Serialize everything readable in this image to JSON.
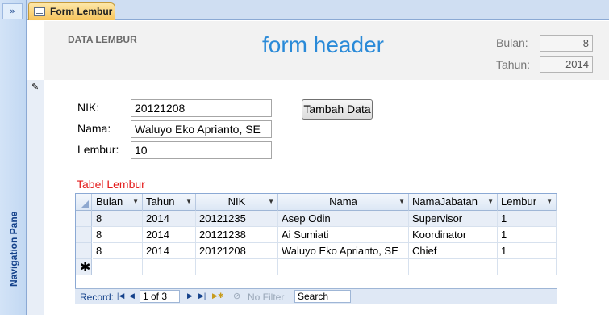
{
  "nav_pane": {
    "toggle": "»",
    "label": "Navigation Pane"
  },
  "tab": {
    "label": "Form Lembur"
  },
  "header": {
    "section_label": "DATA LEMBUR",
    "title": "form header",
    "bulan_label": "Bulan:",
    "bulan_value": "8",
    "tahun_label": "Tahun:",
    "tahun_value": "2014"
  },
  "detail": {
    "nik_label": "NIK:",
    "nik_value": "20121208",
    "nama_label": "Nama:",
    "nama_value": "Waluyo Eko Aprianto, SE",
    "lembur_label": "Lembur:",
    "lembur_value": "10",
    "add_button": "Tambah Data",
    "table_title": "Tabel Lembur"
  },
  "datasheet": {
    "columns": [
      "Bulan",
      "Tahun",
      "NIK",
      "Nama",
      "NamaJabatan",
      "Lembur"
    ],
    "rows": [
      [
        "8",
        "2014",
        "20121235",
        "Asep Odin",
        "Supervisor",
        "1"
      ],
      [
        "8",
        "2014",
        "20121238",
        "Ai Sumiati",
        "Koordinator",
        "1"
      ],
      [
        "8",
        "2014",
        "20121208",
        "Waluyo Eko Aprianto, SE",
        "Chief",
        "1"
      ]
    ],
    "new_row_marker": "✱"
  },
  "record_nav": {
    "label": "Record:",
    "position": "1 of 3",
    "filter": "No Filter",
    "search": "Search"
  }
}
